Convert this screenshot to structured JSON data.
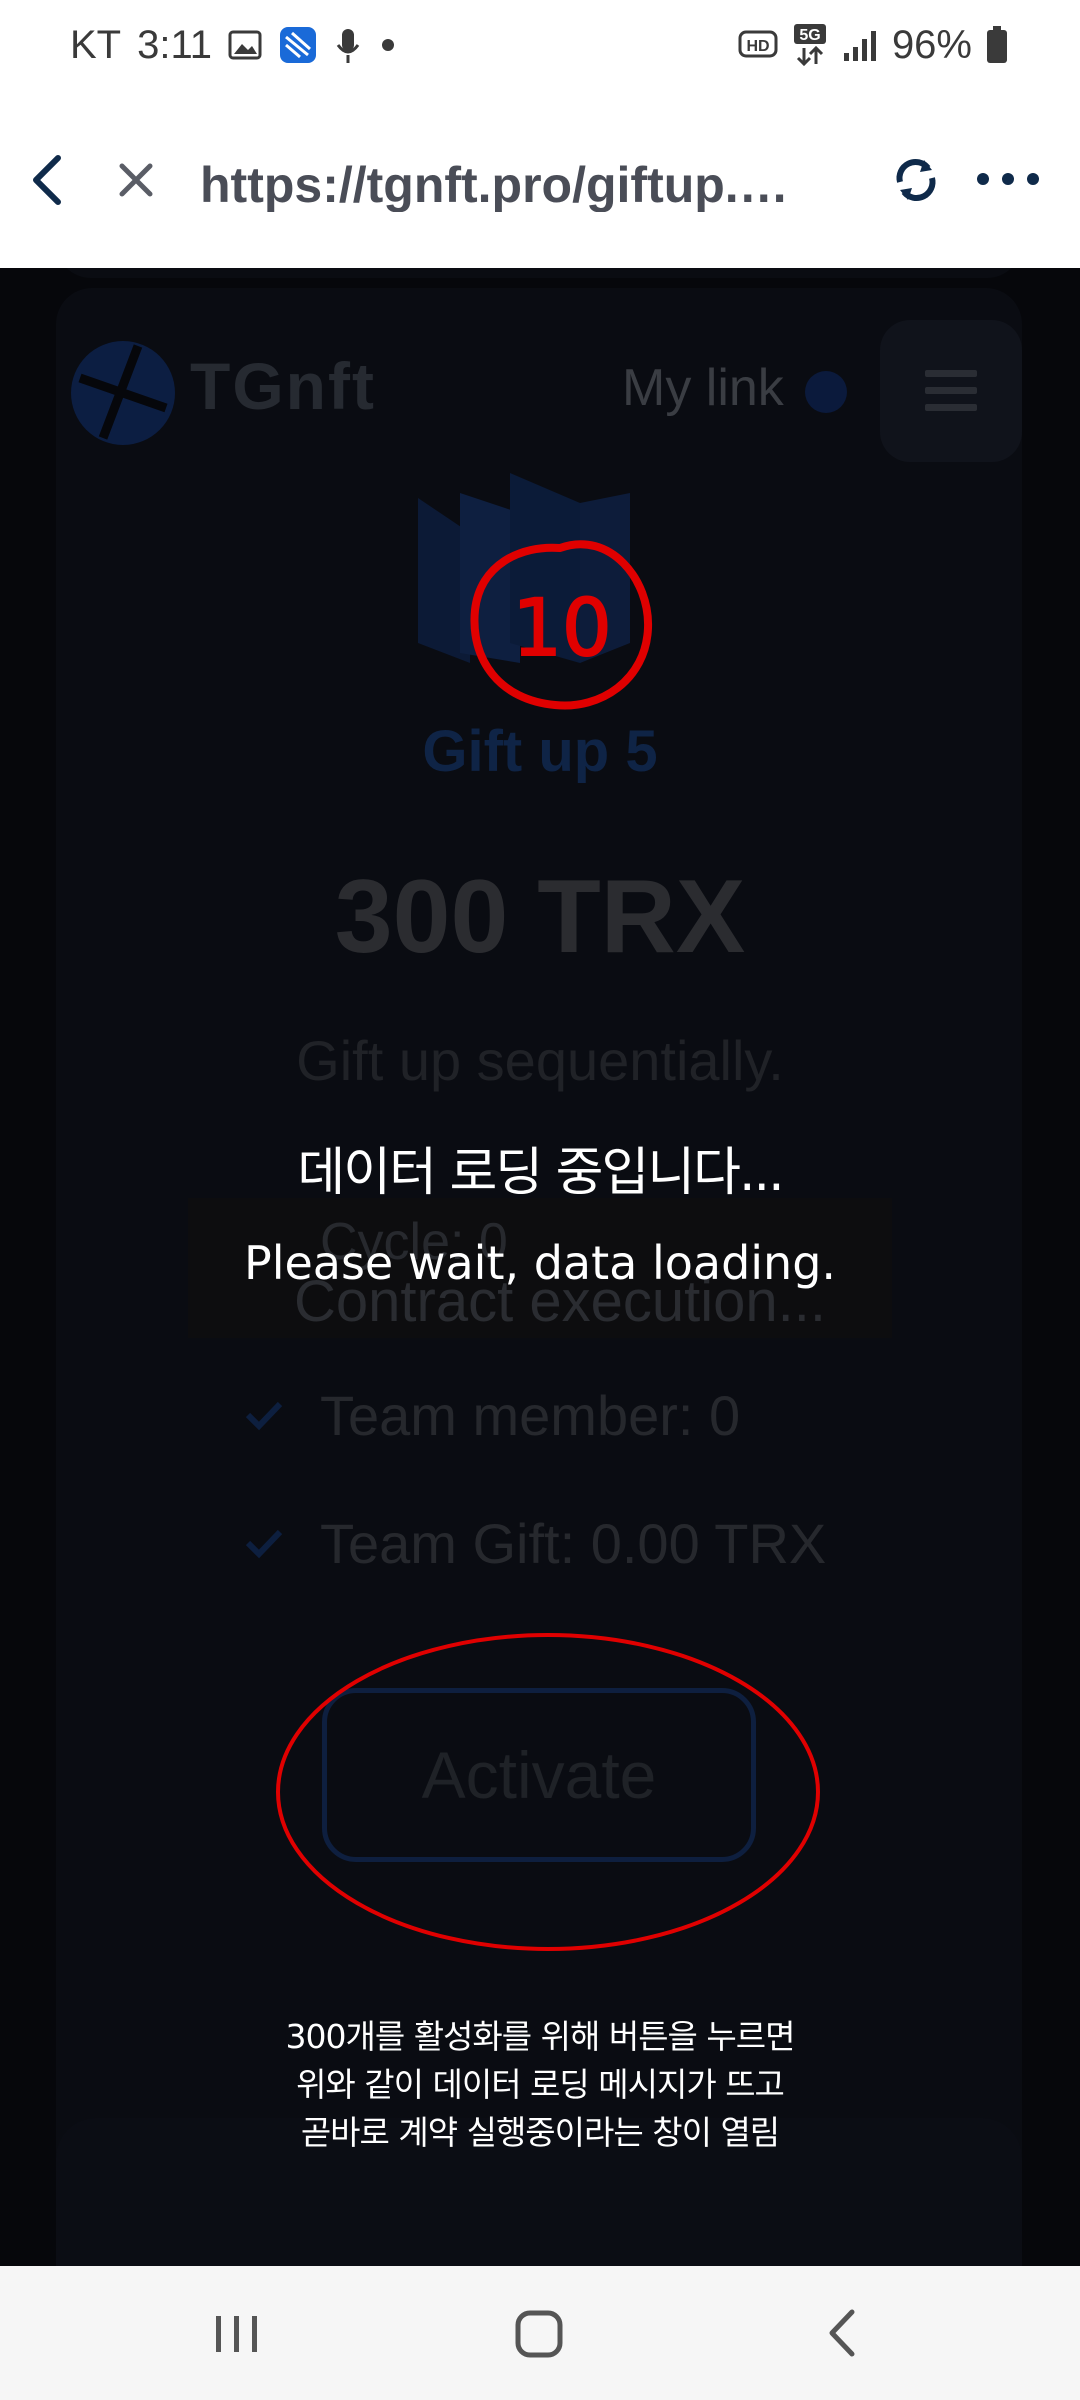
{
  "status_bar": {
    "carrier": "KT",
    "time": "3:11",
    "battery": "96%",
    "network": "5G",
    "hd_badge": "HD",
    "icons": [
      "image-icon",
      "app-icon",
      "mic-icon",
      "dot-icon",
      "hd-icon",
      "5g-icon",
      "signal-icon",
      "battery-icon"
    ]
  },
  "browser": {
    "url": "https://tgnft.pro/giftup.…",
    "icons": [
      "back-icon",
      "close-icon",
      "refresh-icon",
      "more-icon"
    ]
  },
  "page": {
    "logo": "TGnft",
    "my_link": "My link",
    "banner_number": "10",
    "gift_title": "Gift up 5",
    "price": "300 TRX",
    "subtitle": "Gift up sequentially.",
    "cycle": "Cycle: 0",
    "contract_status": "Contract execution...",
    "features": [
      {
        "label": "Team member: 0"
      },
      {
        "label": "Team Gift: 0.00 TRX"
      }
    ],
    "activate_label": "Activate"
  },
  "overlay": {
    "loading_ko": "데이터 로딩 중입니다...",
    "loading_en": "Please wait, data loading.",
    "note_lines": [
      "300개를 활성화를 위해 버튼을 누르면",
      "위와 같이 데이터 로딩 메시지가 뜨고",
      "곧바로 계약 실행중이라는 창이 열림"
    ]
  },
  "colors": {
    "annotation_red": "#e00000",
    "dim_background": "#06070b",
    "accent_blue": "#0f2446"
  },
  "nav_bar": {
    "icons": [
      "recent-apps-icon",
      "home-icon",
      "back-nav-icon"
    ]
  }
}
